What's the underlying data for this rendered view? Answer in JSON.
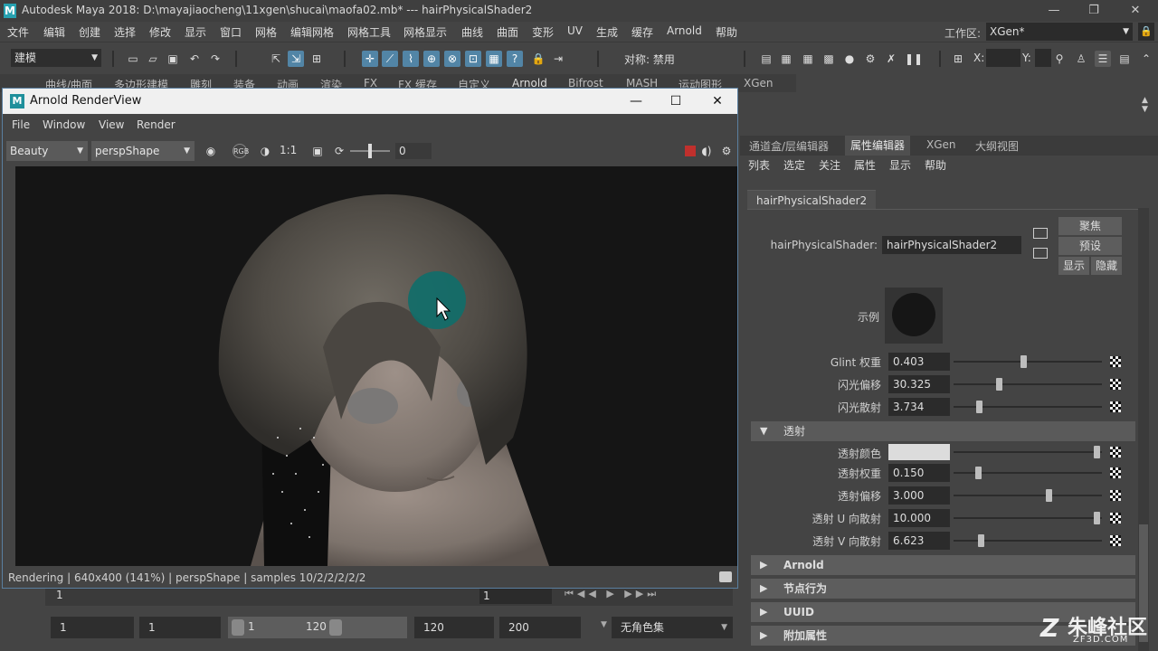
{
  "window": {
    "title": "Autodesk Maya 2018: D:\\mayajiaocheng\\11xgen\\shucai\\maofa02.mb*   ---   hairPhysicalShader2",
    "logo_letter": "M",
    "minimize": "—",
    "restore": "❐",
    "close": "✕"
  },
  "menubar": {
    "items": [
      "文件",
      "编辑",
      "创建",
      "选择",
      "修改",
      "显示",
      "窗口",
      "网格",
      "编辑网格",
      "网格工具",
      "网格显示",
      "曲线",
      "曲面",
      "变形",
      "UV",
      "生成",
      "缓存",
      "Arnold",
      "帮助"
    ],
    "workspace_label": "工作区:",
    "workspace_value": "XGen*"
  },
  "toolbar": {
    "mode": "建模",
    "symmetry": "对称: 禁用",
    "x_label": "X:",
    "y_label": "Y:"
  },
  "shelf": {
    "tabs": [
      "曲线/曲面",
      "多边形建模",
      "雕刻",
      "装备",
      "动画",
      "渲染",
      "FX",
      "FX 缓存",
      "自定义",
      "Arnold",
      "Bifrost",
      "MASH",
      "运动图形",
      "XGen"
    ]
  },
  "render_view": {
    "title": "Arnold RenderView",
    "logo_letter": "M",
    "menu": [
      "File",
      "Window",
      "View",
      "Render"
    ],
    "aov": "Beauty",
    "camera": "perspShape",
    "ratio": "1:1",
    "exposure": "0",
    "status": "Rendering | 640x400 (141%) | perspShape  | samples 10/2/2/2/2/2"
  },
  "attribute_editor": {
    "tabs": [
      "通道盒/层编辑器",
      "属性编辑器",
      "XGen",
      "大纲视图"
    ],
    "active_tab": "属性编辑器",
    "menu": [
      "列表",
      "选定",
      "关注",
      "属性",
      "显示",
      "帮助"
    ],
    "node_tab": "hairPhysicalShader2",
    "node_label": "hairPhysicalShader:",
    "node_value": "hairPhysicalShader2",
    "buttons": {
      "focus": "聚焦",
      "presets": "预设",
      "show": "显示",
      "hide": "隐藏"
    },
    "sample_label": "示例",
    "glint": [
      {
        "label": "Glint 权重",
        "value": "0.403",
        "pos": 0.47
      },
      {
        "label": "闪光偏移",
        "value": "30.325",
        "pos": 0.3
      },
      {
        "label": "闪光散射",
        "value": "3.734",
        "pos": 0.16
      }
    ],
    "transmission_section": "透射",
    "transmission_color_label": "透射颜色",
    "transmission_color_pos": 0.99,
    "transmission": [
      {
        "label": "透射权重",
        "value": "0.150",
        "pos": 0.15
      },
      {
        "label": "透射偏移",
        "value": "3.000",
        "pos": 0.65
      },
      {
        "label": "透射 U 向散射",
        "value": "10.000",
        "pos": 0.99
      },
      {
        "label": "透射 V 向散射",
        "value": "6.623",
        "pos": 0.17
      }
    ],
    "sections": [
      "Arnold",
      "节点行为",
      "UUID",
      "附加属性"
    ]
  },
  "timeline": {
    "current_frame": "1",
    "frame_box": "1"
  },
  "range": {
    "start": "1",
    "playback_start": "1",
    "slider_start": "1",
    "slider_end": "120",
    "end": "120",
    "anim_end": "200",
    "char_set": "无角色集"
  },
  "watermark": {
    "big": "朱峰社区",
    "small": "ZF3D.COM",
    "z": "Z"
  },
  "colors": {
    "accent_blue": "#5285a6",
    "render_bg": "#151515",
    "cursor_highlight": "#0f6e6a"
  }
}
